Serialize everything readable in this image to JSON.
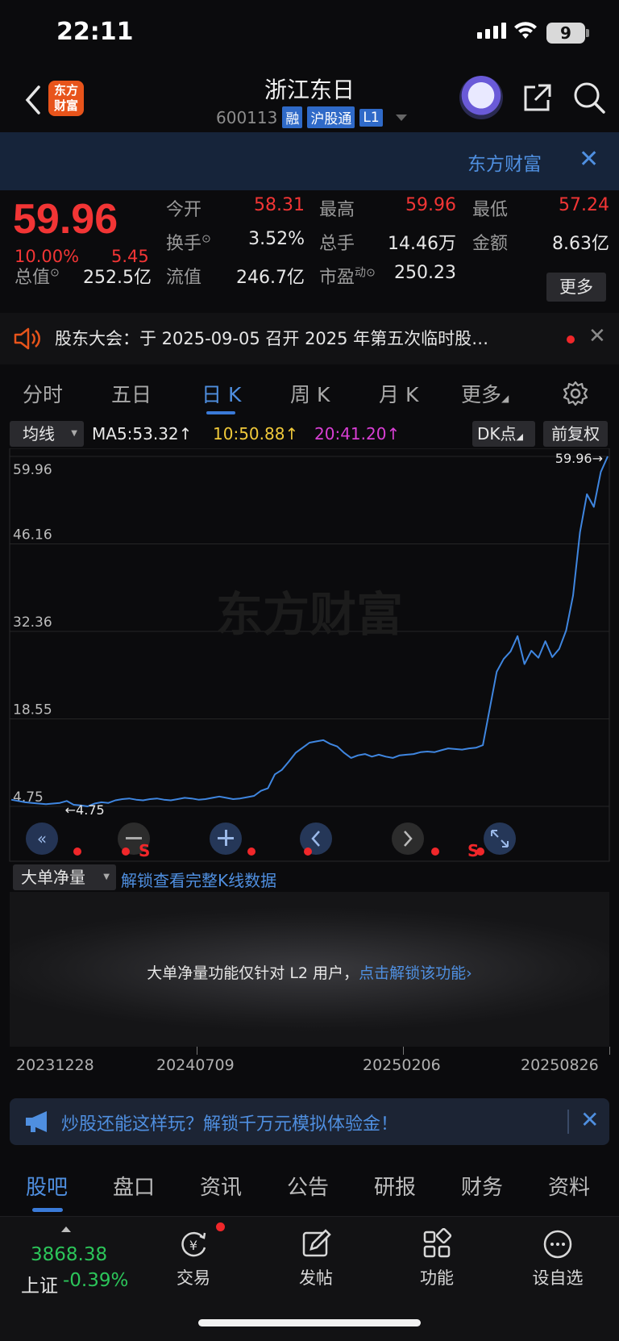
{
  "status": {
    "time": "22:11",
    "battery": "9"
  },
  "header": {
    "logo_text": "东方\n财富",
    "stock_name": "浙江东日",
    "stock_code": "600113",
    "tags": [
      "融",
      "沪股通",
      "L1"
    ]
  },
  "banner": {
    "text": "东方财富"
  },
  "quote": {
    "price": "59.96",
    "pct": "10.00%",
    "change": "5.45",
    "open_label": "今开",
    "open": "58.31",
    "high_label": "最高",
    "high": "59.96",
    "low_label": "最低",
    "low": "57.24",
    "turnover_label": "换手",
    "turnover": "3.52%",
    "volume_label": "总手",
    "volume": "14.46万",
    "amount_label": "金额",
    "amount": "8.63亿",
    "mcap_label": "总值",
    "mcap": "252.5亿",
    "float_label": "流值",
    "float_cap": "246.7亿",
    "pe_label": "市盈",
    "pe_sup": "动",
    "pe": "250.23",
    "more_btn": "更多"
  },
  "notice": {
    "text": "股东大会：于 2025-09-05 召开 2025 年第五次临时股…"
  },
  "ktabs": [
    "分时",
    "五日",
    "日 K",
    "周 K",
    "月 K",
    "更多"
  ],
  "ma": {
    "select": "均线",
    "ma5": "MA5:53.32↑",
    "ma10": "10:50.88↑",
    "ma20": "20:41.20↑",
    "dk": "DK点",
    "fq": "前复权"
  },
  "chart_data": {
    "type": "line",
    "title": "",
    "watermark": "东方财富",
    "y_ticks": [
      "59.96",
      "46.16",
      "32.36",
      "18.55",
      "4.75"
    ],
    "ylim": [
      4.75,
      59.96
    ],
    "x_ticks": [
      "20231228",
      "20240709",
      "20250206",
      "20250826"
    ],
    "series": [
      {
        "color": "#3f86e0",
        "values": [
          5.8,
          5.6,
          5.4,
          5.3,
          5.2,
          5.1,
          5.2,
          5.3,
          5.6,
          5.0,
          4.9,
          4.75,
          5.2,
          5.4,
          5.3,
          5.7,
          5.9,
          6.0,
          5.8,
          5.7,
          5.9,
          6.0,
          5.8,
          5.7,
          5.9,
          6.1,
          6.0,
          5.8,
          5.9,
          6.1,
          6.3,
          6.1,
          5.9,
          6.0,
          6.2,
          6.4,
          7.2,
          7.6,
          9.8,
          10.5,
          11.8,
          13.2,
          14.0,
          14.8,
          15.0,
          15.2,
          14.6,
          14.2,
          13.2,
          12.4,
          12.8,
          13.0,
          12.6,
          12.9,
          12.6,
          12.4,
          12.8,
          12.9,
          13.0,
          13.3,
          13.4,
          13.3,
          13.6,
          13.9,
          13.8,
          13.7,
          13.9,
          14.0,
          14.4,
          20.2,
          26.0,
          28.0,
          29.2,
          31.6,
          27.2,
          29.3,
          28.2,
          30.8,
          28.3,
          29.6,
          32.5,
          38.0,
          48.0,
          54.0,
          52.0,
          57.5,
          59.96
        ],
        "last_label": "59.96",
        "min_label": "4.75"
      }
    ],
    "signals": [
      "S",
      "S"
    ]
  },
  "big_order": {
    "select": "大单净量",
    "link": "解锁查看完整K线数据",
    "message": "大单净量功能仅针对 L2 用户，",
    "message_link": "点击解锁该功能"
  },
  "promo": {
    "text": "炒股还能这样玩？解锁千万元模拟体验金！"
  },
  "subtabs": [
    "股吧",
    "盘口",
    "资讯",
    "公告",
    "研报",
    "财务",
    "资料"
  ],
  "bottom": {
    "index_value": "3868.38",
    "index_name": "上证",
    "index_pct": "-0.39%",
    "items": [
      "交易",
      "发帖",
      "功能",
      "设自选"
    ]
  }
}
